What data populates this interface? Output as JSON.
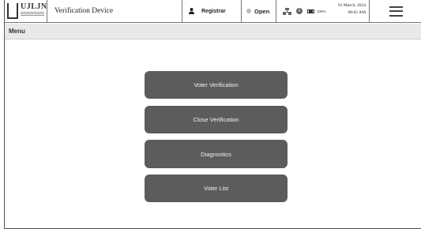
{
  "header": {
    "logo_text": "UJLJN",
    "device_title": "Verification Device",
    "user_label": "Registrar",
    "status_label": "Open",
    "battery_text": "100%",
    "date": "01 March, 2024",
    "time": "08:05 AM",
    "icons": {
      "user": "person-icon",
      "status": "status-dot-icon",
      "network": "network-icon",
      "info": "info-icon",
      "battery": "battery-icon",
      "menu": "hamburger-menu-icon"
    }
  },
  "menu_title": "Menu",
  "buttons": {
    "voter_verification": "Voter Verification",
    "close_verification": "Close Verification",
    "diagnostics": "Diagnostics",
    "voter_list": "Voter List"
  },
  "colors": {
    "button_bg": "#5c5c5c",
    "button_text": "#f2f2f2",
    "menu_header_bg": "#e9e9e9"
  }
}
